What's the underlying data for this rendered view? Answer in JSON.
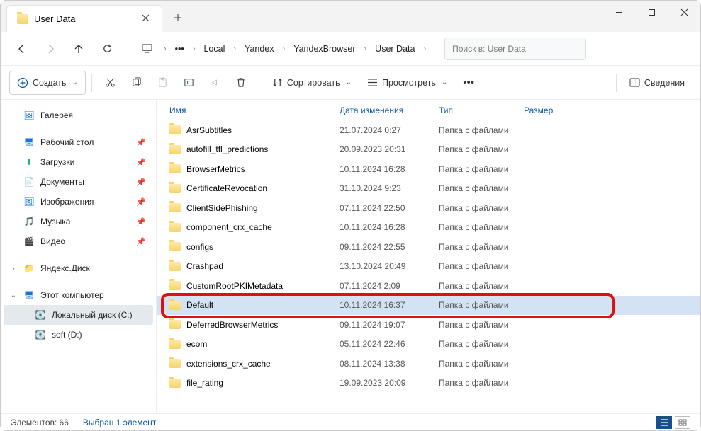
{
  "window": {
    "title": "User Data"
  },
  "breadcrumbs": {
    "items": [
      "Local",
      "Yandex",
      "YandexBrowser",
      "User Data"
    ]
  },
  "search": {
    "placeholder": "Поиск в: User Data"
  },
  "toolbar": {
    "create": "Создать",
    "sort": "Сортировать",
    "view": "Просмотреть",
    "details": "Сведения"
  },
  "sidebar": {
    "gallery": "Галерея",
    "desktop": "Рабочий стол",
    "downloads": "Загрузки",
    "documents": "Документы",
    "pictures": "Изображения",
    "music": "Музыка",
    "videos": "Видео",
    "yandexdisk": "Яндекс.Диск",
    "thispc": "Этот компьютер",
    "localdisk": "Локальный диск (C:)",
    "soft": "soft (D:)"
  },
  "columns": {
    "name": "Имя",
    "date": "Дата изменения",
    "type": "Тип",
    "size": "Размер"
  },
  "files": [
    {
      "name": "AsrSubtitles",
      "date": "21.07.2024 0:27",
      "type": "Папка с файлами"
    },
    {
      "name": "autofill_tfl_predictions",
      "date": "20.09.2023 20:31",
      "type": "Папка с файлами"
    },
    {
      "name": "BrowserMetrics",
      "date": "10.11.2024 16:28",
      "type": "Папка с файлами"
    },
    {
      "name": "CertificateRevocation",
      "date": "31.10.2024 9:23",
      "type": "Папка с файлами"
    },
    {
      "name": "ClientSidePhishing",
      "date": "07.11.2024 22:50",
      "type": "Папка с файлами"
    },
    {
      "name": "component_crx_cache",
      "date": "10.11.2024 16:28",
      "type": "Папка с файлами"
    },
    {
      "name": "configs",
      "date": "09.11.2024 22:55",
      "type": "Папка с файлами"
    },
    {
      "name": "Crashpad",
      "date": "13.10.2024 20:49",
      "type": "Папка с файлами"
    },
    {
      "name": "CustomRootPKIMetadata",
      "date": "07.11.2024 2:09",
      "type": "Папка с файлами"
    },
    {
      "name": "Default",
      "date": "10.11.2024 16:37",
      "type": "Папка с файлами",
      "selected": true
    },
    {
      "name": "DeferredBrowserMetrics",
      "date": "09.11.2024 19:07",
      "type": "Папка с файлами"
    },
    {
      "name": "ecom",
      "date": "05.11.2024 22:46",
      "type": "Папка с файлами"
    },
    {
      "name": "extensions_crx_cache",
      "date": "08.11.2024 13:38",
      "type": "Папка с файлами"
    },
    {
      "name": "file_rating",
      "date": "19.09.2023 20:09",
      "type": "Папка с файлами"
    }
  ],
  "status": {
    "count_label": "Элементов:",
    "count": "66",
    "selection": "Выбран 1 элемент"
  }
}
